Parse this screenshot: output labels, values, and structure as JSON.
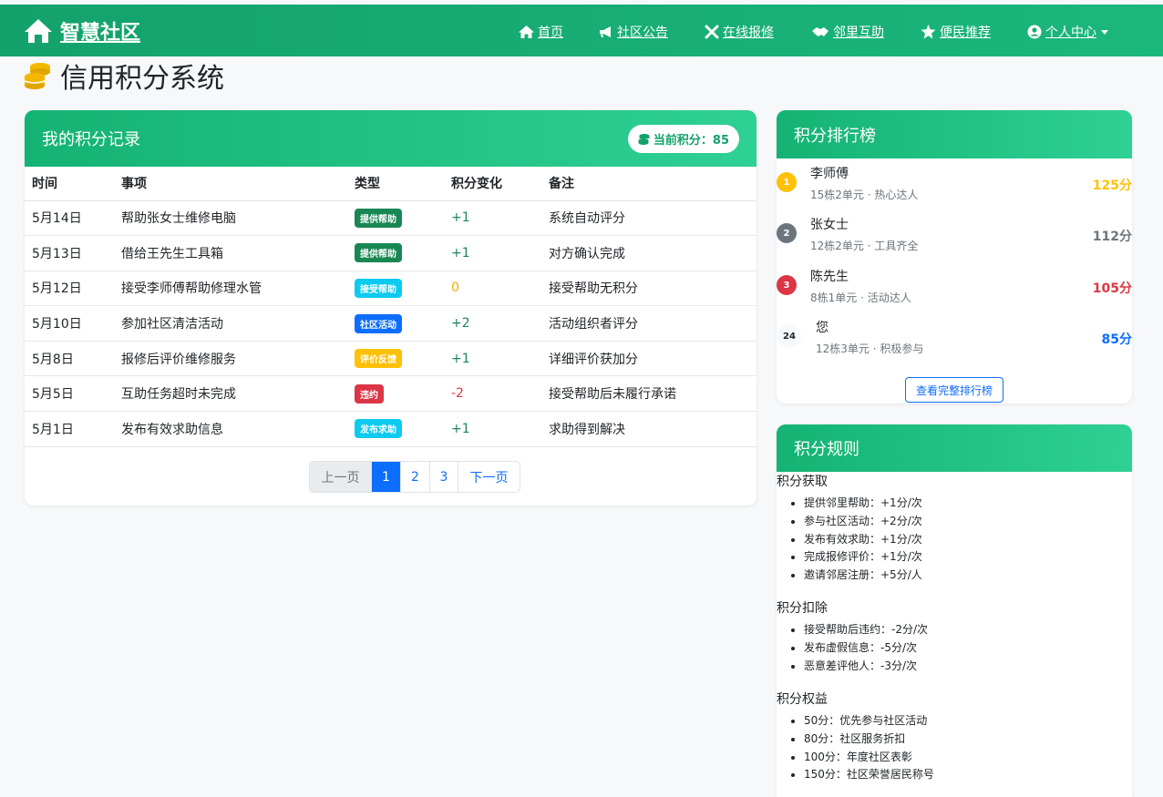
{
  "nav": {
    "brand": "智慧社区",
    "items": [
      {
        "label": "首页",
        "icon": "home-icon"
      },
      {
        "label": "社区公告",
        "icon": "bullhorn-icon"
      },
      {
        "label": "在线报修",
        "icon": "tools-icon"
      },
      {
        "label": "邻里互助",
        "icon": "handshake-icon"
      },
      {
        "label": "便民推荐",
        "icon": "star-icon"
      },
      {
        "label": "个人中心",
        "icon": "user-circle-icon"
      }
    ],
    "brand_color": "#14a26c"
  },
  "page": {
    "title": "信用积分系统"
  },
  "records": {
    "title": "我的积分记录",
    "current_points_label": "当前积分：85",
    "columns": [
      "时间",
      "事项",
      "类型",
      "积分变化",
      "备注"
    ],
    "rows": [
      {
        "date": "5月14日",
        "item": "帮助张女士维修电脑",
        "type": "提供帮助",
        "type_color": "#198754",
        "change": "+1",
        "note": "系统自动评分"
      },
      {
        "date": "5月13日",
        "item": "借给王先生工具箱",
        "type": "提供帮助",
        "type_color": "#198754",
        "change": "+1",
        "note": "对方确认完成"
      },
      {
        "date": "5月12日",
        "item": "接受李师傅帮助修理水管",
        "type": "接受帮助",
        "type_color": "#0dcaf0",
        "change": "0",
        "note": "接受帮助无积分"
      },
      {
        "date": "5月10日",
        "item": "参加社区清洁活动",
        "type": "社区活动",
        "type_color": "#0d6efd",
        "change": "+2",
        "note": "活动组织者评分"
      },
      {
        "date": "5月8日",
        "item": "报修后评价维修服务",
        "type": "评价反馈",
        "type_color": "#ffc107",
        "change": "+1",
        "note": "详细评价获加分"
      },
      {
        "date": "5月5日",
        "item": "互助任务超时未完成",
        "type": "违约",
        "type_color": "#dc3545",
        "change": "-2",
        "note": "接受帮助后未履行承诺"
      },
      {
        "date": "5月1日",
        "item": "发布有效求助信息",
        "type": "发布求助",
        "type_color": "#0dcaf0",
        "change": "+1",
        "note": "求助得到解决"
      }
    ],
    "pagination": [
      "上一页",
      "1",
      "2",
      "3",
      "下一页"
    ],
    "active_page": "1"
  },
  "ranking": {
    "title": "积分排行榜",
    "entries": [
      {
        "rank": "1",
        "name": "李师傅",
        "sub": "15栋2单元 · 热心达人",
        "score": "125分",
        "color": "#ffc107"
      },
      {
        "rank": "2",
        "name": "张女士",
        "sub": "12栋2单元 · 工具齐全",
        "score": "112分",
        "color": "#6c757d"
      },
      {
        "rank": "3",
        "name": "陈先生",
        "sub": "8栋1单元 · 活动达人",
        "score": "105分",
        "color": "#dc3545"
      },
      {
        "rank": "24",
        "name": "您",
        "sub": "12栋3单元 · 积极参与",
        "score": "85分",
        "color": "#0d6efd"
      }
    ],
    "button": "查看完整排行榜"
  },
  "rules": {
    "title": "积分规则",
    "sections": [
      {
        "title": "积分获取",
        "items": [
          "提供邻里帮助：+1分/次",
          "参与社区活动：+2分/次",
          "发布有效求助：+1分/次",
          "完成报修评价：+1分/次",
          "邀请邻居注册：+5分/人"
        ]
      },
      {
        "title": "积分扣除",
        "items": [
          "接受帮助后违约：-2分/次",
          "发布虚假信息：-5分/次",
          "恶意差评他人：-3分/次"
        ]
      },
      {
        "title": "积分权益",
        "items": [
          "50分：优先参与社区活动",
          "80分：社区服务折扣",
          "100分：年度社区表彰",
          "150分：社区荣誉居民称号"
        ]
      }
    ]
  }
}
